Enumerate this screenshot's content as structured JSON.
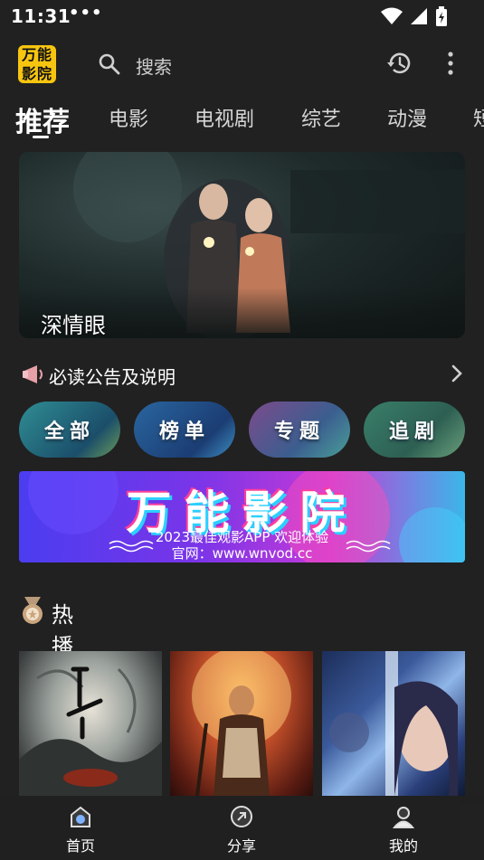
{
  "status_bar": {
    "time": "11:31",
    "dots": "•••"
  },
  "top_bar": {
    "logo_line1": "万能",
    "logo_line2": "影院",
    "search_placeholder": "搜索"
  },
  "tabs": [
    "推荐",
    "电影",
    "电视剧",
    "综艺",
    "动漫",
    "短"
  ],
  "banner": {
    "title": "深情眼"
  },
  "notice": {
    "label": "必读公告及说明"
  },
  "categories": [
    "全部",
    "榜单",
    "专题",
    "追剧"
  ],
  "promo": {
    "headline": "万能影院",
    "subtitle": "2023最佳观影APP 欢迎体验",
    "site": "官网：www.wnvod.cc"
  },
  "section": {
    "title": "热播"
  },
  "bottom_nav": {
    "home": "首页",
    "share": "分享",
    "mine": "我的"
  },
  "colors": {
    "background": "#212121",
    "logo": "#f7c510",
    "accent": "#ffffff"
  }
}
